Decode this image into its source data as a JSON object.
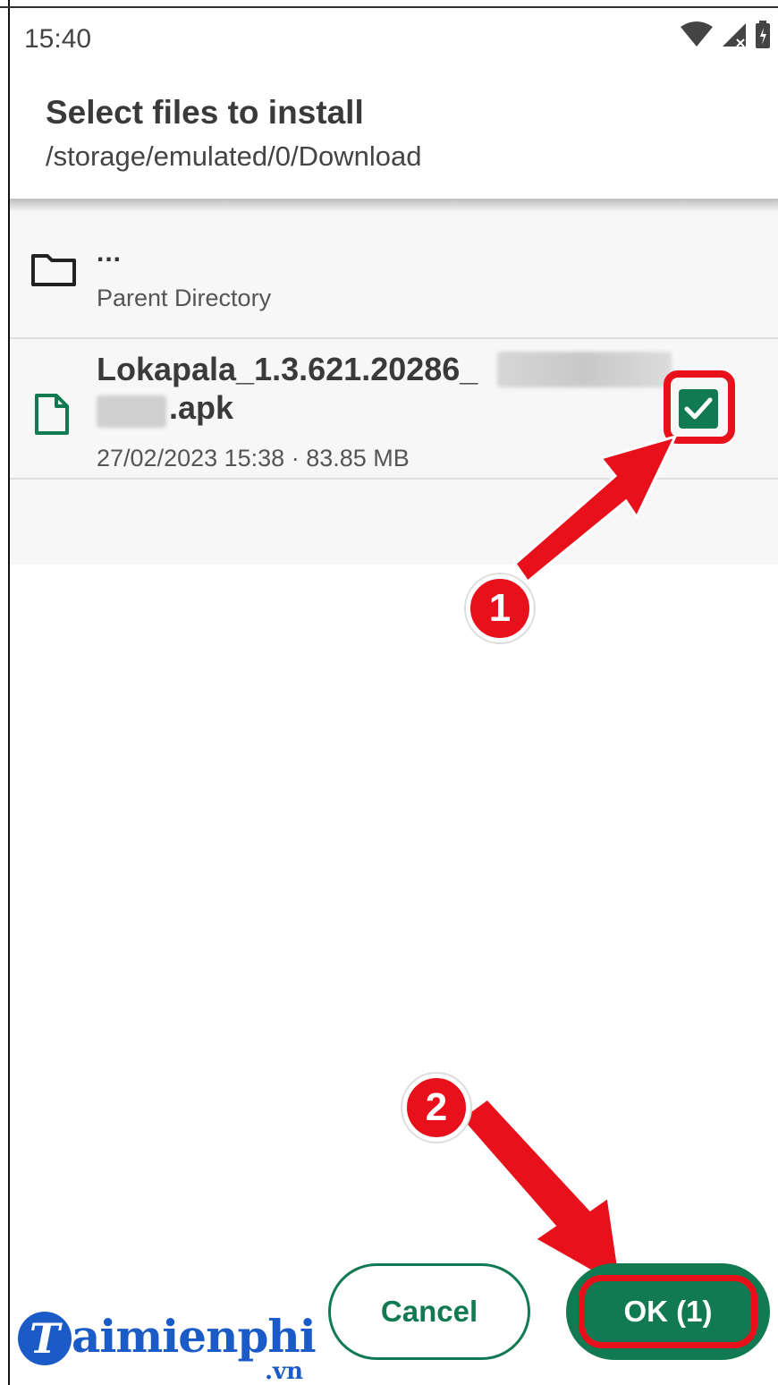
{
  "status_bar": {
    "time": "15:40",
    "icons": [
      "wifi-icon",
      "signal-icon",
      "battery-icon"
    ]
  },
  "header": {
    "title": "Select files to install",
    "path": "/storage/emulated/0/Download"
  },
  "file_list": {
    "parent": {
      "name": "...",
      "label": "Parent Directory",
      "icon": "folder-icon"
    },
    "files": [
      {
        "name_visible_start": "Lokapala_1.3.621.20286_",
        "name_visible_end": ".apk",
        "meta": "27/02/2023 15:38 · 83.85 MB",
        "icon": "file-icon",
        "checked": true
      }
    ]
  },
  "buttons": {
    "cancel_label": "Cancel",
    "ok_label": "OK (1)"
  },
  "annotations": {
    "badge_1": "1",
    "badge_2": "2",
    "accent_color": "#e8101a"
  },
  "watermark": {
    "initial": "T",
    "text": "aimienphi",
    "suffix": ".vn"
  },
  "colors": {
    "primary": "#117a52",
    "logo": "#1a5bc7"
  }
}
